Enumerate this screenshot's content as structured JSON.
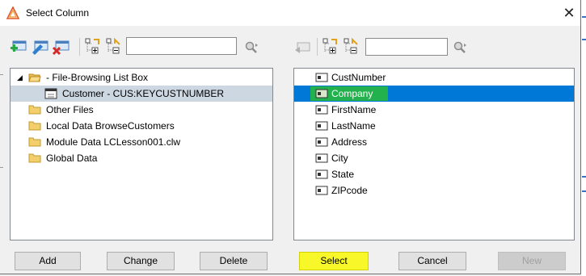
{
  "window": {
    "title": "Select Column"
  },
  "left_tree": {
    "items": [
      {
        "label": "- File-Browsing List Box",
        "icon": "folder-open-icon"
      },
      {
        "label": "Customer - CUS:KEYCUSTNUMBER",
        "icon": "table-icon"
      },
      {
        "label": "Other Files",
        "icon": "folder-icon"
      },
      {
        "label": "Local Data BrowseCustomers",
        "icon": "folder-icon"
      },
      {
        "label": "Module Data LCLesson001.clw",
        "icon": "folder-icon"
      },
      {
        "label": "Global Data",
        "icon": "folder-icon"
      }
    ]
  },
  "right_list": {
    "items": [
      {
        "label": "CustNumber"
      },
      {
        "label": "Company"
      },
      {
        "label": "FirstName"
      },
      {
        "label": "LastName"
      },
      {
        "label": "Address"
      },
      {
        "label": "City"
      },
      {
        "label": "State"
      },
      {
        "label": "ZIPcode"
      }
    ],
    "selected": "Company"
  },
  "buttons": {
    "add": "Add",
    "change": "Change",
    "delete": "Delete",
    "select": "Select",
    "cancel": "Cancel",
    "new": "New"
  },
  "search": {
    "left_value": "",
    "right_value": ""
  },
  "colors": {
    "selection": "#0078d7",
    "highlight": "#f7f72a",
    "field_highlight": "#22b14c"
  }
}
